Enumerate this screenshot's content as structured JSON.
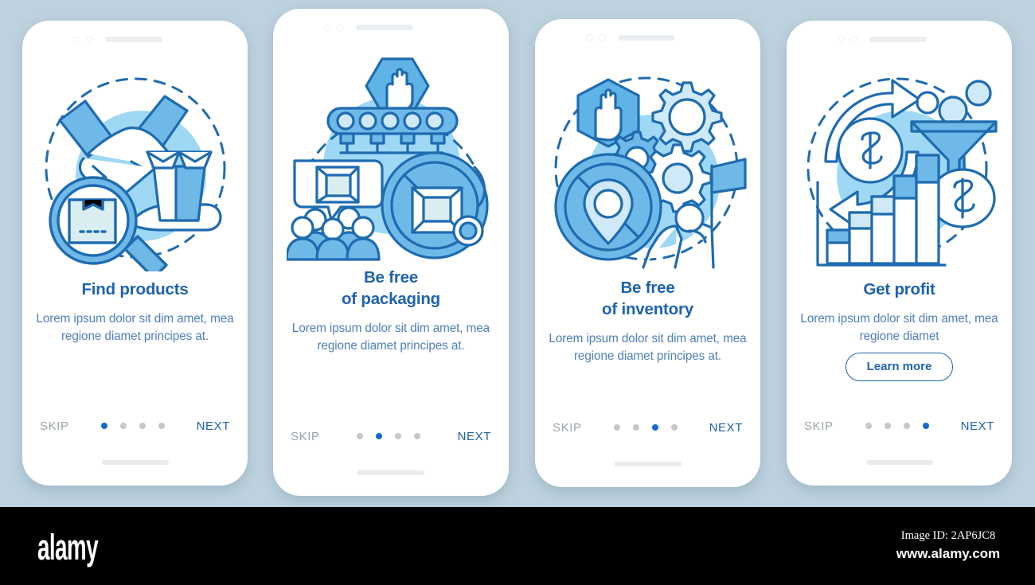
{
  "background_color": "#bdd2de",
  "brand": {
    "title_color": "#1e63ae",
    "body_color": "#4f7fba",
    "accent_dot": "#1669cf",
    "inactive_dot": "#c3c8cb",
    "skip_color": "#9aa3a8",
    "art_blue": "#1e6bb0",
    "art_fill_light": "#bfe3f7",
    "art_fill_mid": "#7cc4ef",
    "art_fill_pale": "#daeef2"
  },
  "screens": [
    {
      "id": "find-products",
      "illustration": "handshake-magnifier-box-icon",
      "title_lines": [
        "Find products"
      ],
      "body": "Lorem ipsum dolor sit dim amet, mea regione diamet principes at.",
      "cta": null,
      "skip_label": "SKIP",
      "next_label": "NEXT",
      "dots_total": 4,
      "dots_active_index": 0
    },
    {
      "id": "be-free-of-packaging",
      "illustration": "conveyor-stophand-people-noparcel-icon",
      "title_lines": [
        "Be free",
        "of packaging"
      ],
      "body": "Lorem ipsum dolor sit dim amet, mea regione diamet principes at.",
      "cta": null,
      "skip_label": "SKIP",
      "next_label": "NEXT",
      "dots_total": 4,
      "dots_active_index": 1
    },
    {
      "id": "be-free-of-inventory",
      "illustration": "stophand-gears-nolocation-flagperson-icon",
      "title_lines": [
        "Be free",
        "of inventory"
      ],
      "body": "Lorem ipsum dolor sit dim amet, mea regione diamet principes at.",
      "cta": null,
      "skip_label": "SKIP",
      "next_label": "NEXT",
      "dots_total": 4,
      "dots_active_index": 2
    },
    {
      "id": "get-profit",
      "illustration": "money-cycle-funnel-bargraph-icon",
      "title_lines": [
        "Get profit"
      ],
      "body": "Lorem ipsum dolor sit dim amet, mea regione diamet",
      "cta": "Learn more",
      "skip_label": "SKIP",
      "next_label": "NEXT",
      "dots_total": 4,
      "dots_active_index": 3
    }
  ],
  "watermark": {
    "logo": "alamy",
    "image_id": "Image ID: 2AP6JC8",
    "site": "www.alamy.com",
    "ghost_text": "alamy"
  }
}
